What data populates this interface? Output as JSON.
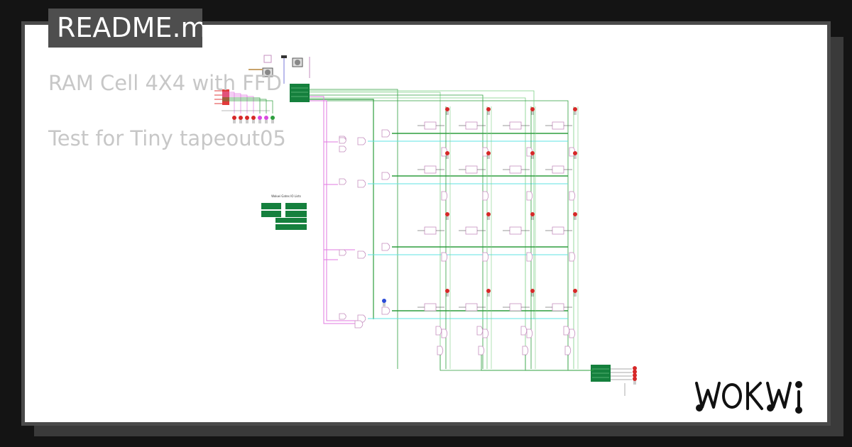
{
  "readme": {
    "tab_label": "README.md",
    "title": "RAM Cell 4X4 with FFD",
    "subtitle": "Test for Tiny tapeout05"
  },
  "diagram": {
    "legend_title": "Wokwi Gates IO Lists",
    "brand": "WOKWI",
    "colors": {
      "wire_green": "#2e9e3e",
      "wire_light_green": "#7ccf85",
      "wire_cyan": "#5fe3e3",
      "wire_magenta": "#e27ae2",
      "chip_green": "#15803d",
      "gate_outline": "#c58fbf",
      "led_red": "#d62828",
      "led_blue": "#2a4bd7"
    }
  }
}
